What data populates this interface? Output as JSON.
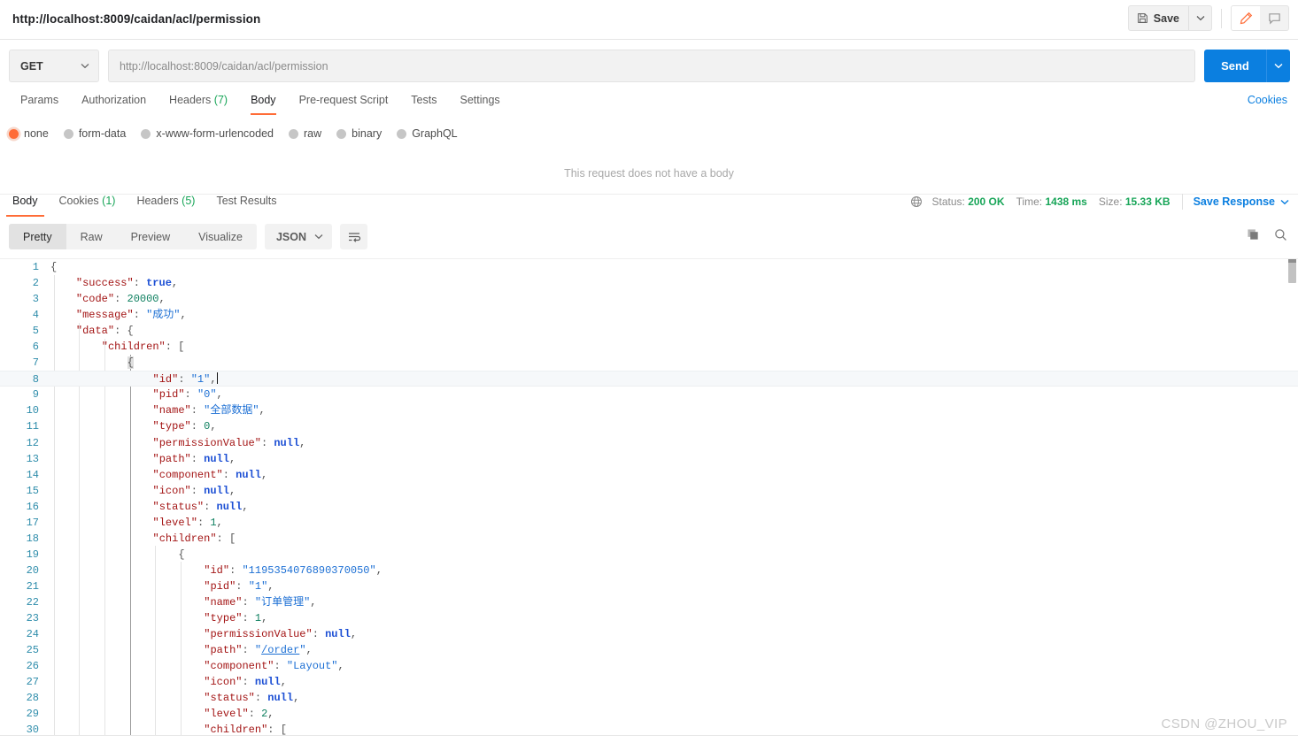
{
  "window": {
    "tab_title": "http://localhost:8009/caidan/acl/permission"
  },
  "titlebar": {
    "save_label": "Save",
    "save_icon": "floppy-disk-icon",
    "save_caret_icon": "chevron-down-icon",
    "edit_icon": "pencil-icon",
    "comment_icon": "comment-icon",
    "accent_orange": "#ff6c37"
  },
  "request": {
    "method": "GET",
    "method_caret_icon": "chevron-down-icon",
    "url_value": "http://localhost:8009/caidan/acl/permission",
    "send_label": "Send",
    "send_caret_icon": "chevron-down-icon",
    "send_color": "#0b7fe0",
    "tabs": [
      {
        "label": "Params",
        "count": "",
        "active": false
      },
      {
        "label": "Authorization",
        "count": "",
        "active": false
      },
      {
        "label": "Headers",
        "count": "(7)",
        "active": false
      },
      {
        "label": "Body",
        "count": "",
        "active": true
      },
      {
        "label": "Pre-request Script",
        "count": "",
        "active": false
      },
      {
        "label": "Tests",
        "count": "",
        "active": false
      },
      {
        "label": "Settings",
        "count": "",
        "active": false
      }
    ],
    "cookies_link": "Cookies",
    "body_types": [
      {
        "label": "none",
        "selected": true
      },
      {
        "label": "form-data",
        "selected": false
      },
      {
        "label": "x-www-form-urlencoded",
        "selected": false
      },
      {
        "label": "raw",
        "selected": false
      },
      {
        "label": "binary",
        "selected": false
      },
      {
        "label": "GraphQL",
        "selected": false
      }
    ],
    "no_body_message": "This request does not have a body"
  },
  "response": {
    "tabs": [
      {
        "label": "Body",
        "count": "",
        "active": true
      },
      {
        "label": "Cookies",
        "count": "(1)",
        "active": false
      },
      {
        "label": "Headers",
        "count": "(5)",
        "active": false
      },
      {
        "label": "Test Results",
        "count": "",
        "active": false
      }
    ],
    "globe_icon": "globe-icon",
    "status_label": "Status:",
    "status_value": "200 OK",
    "time_label": "Time:",
    "time_value": "1438 ms",
    "size_label": "Size:",
    "size_value": "15.33 KB",
    "save_response_label": "Save Response",
    "save_response_caret_icon": "chevron-down-icon",
    "view_modes": [
      {
        "label": "Pretty",
        "active": true
      },
      {
        "label": "Raw",
        "active": false
      },
      {
        "label": "Preview",
        "active": false
      },
      {
        "label": "Visualize",
        "active": false
      }
    ],
    "format": "JSON",
    "format_caret_icon": "chevron-down-icon",
    "wrap_icon": "word-wrap-icon",
    "copy_icon": "copy-icon",
    "search_icon": "search-icon",
    "status_color": "#18a558"
  },
  "code": {
    "lines": [
      {
        "n": "1",
        "indent": 0,
        "tokens": [
          {
            "t": "punc",
            "v": "{"
          }
        ]
      },
      {
        "n": "2",
        "indent": 1,
        "tokens": [
          {
            "t": "key",
            "v": "\"success\""
          },
          {
            "t": "punc",
            "v": ": "
          },
          {
            "t": "bool",
            "v": "true"
          },
          {
            "t": "punc",
            "v": ","
          }
        ]
      },
      {
        "n": "3",
        "indent": 1,
        "tokens": [
          {
            "t": "key",
            "v": "\"code\""
          },
          {
            "t": "punc",
            "v": ": "
          },
          {
            "t": "num",
            "v": "20000"
          },
          {
            "t": "punc",
            "v": ","
          }
        ]
      },
      {
        "n": "4",
        "indent": 1,
        "tokens": [
          {
            "t": "key",
            "v": "\"message\""
          },
          {
            "t": "punc",
            "v": ": "
          },
          {
            "t": "str",
            "v": "\"成功\""
          },
          {
            "t": "punc",
            "v": ","
          }
        ]
      },
      {
        "n": "5",
        "indent": 1,
        "tokens": [
          {
            "t": "key",
            "v": "\"data\""
          },
          {
            "t": "punc",
            "v": ": "
          },
          {
            "t": "punc",
            "v": "{"
          }
        ]
      },
      {
        "n": "6",
        "indent": 2,
        "tokens": [
          {
            "t": "key",
            "v": "\"children\""
          },
          {
            "t": "punc",
            "v": ": "
          },
          {
            "t": "punc",
            "v": "["
          }
        ]
      },
      {
        "n": "7",
        "indent": 3,
        "tokens": [
          {
            "t": "brace",
            "v": "{"
          }
        ]
      },
      {
        "n": "8",
        "indent": 4,
        "highlight": true,
        "cursor": true,
        "tokens": [
          {
            "t": "key",
            "v": "\"id\""
          },
          {
            "t": "punc",
            "v": ": "
          },
          {
            "t": "str",
            "v": "\"1\""
          },
          {
            "t": "punc",
            "v": ","
          }
        ]
      },
      {
        "n": "9",
        "indent": 4,
        "tokens": [
          {
            "t": "key",
            "v": "\"pid\""
          },
          {
            "t": "punc",
            "v": ": "
          },
          {
            "t": "str",
            "v": "\"0\""
          },
          {
            "t": "punc",
            "v": ","
          }
        ]
      },
      {
        "n": "10",
        "indent": 4,
        "tokens": [
          {
            "t": "key",
            "v": "\"name\""
          },
          {
            "t": "punc",
            "v": ": "
          },
          {
            "t": "str",
            "v": "\"全部数据\""
          },
          {
            "t": "punc",
            "v": ","
          }
        ]
      },
      {
        "n": "11",
        "indent": 4,
        "tokens": [
          {
            "t": "key",
            "v": "\"type\""
          },
          {
            "t": "punc",
            "v": ": "
          },
          {
            "t": "num",
            "v": "0"
          },
          {
            "t": "punc",
            "v": ","
          }
        ]
      },
      {
        "n": "12",
        "indent": 4,
        "tokens": [
          {
            "t": "key",
            "v": "\"permissionValue\""
          },
          {
            "t": "punc",
            "v": ": "
          },
          {
            "t": "null",
            "v": "null"
          },
          {
            "t": "punc",
            "v": ","
          }
        ]
      },
      {
        "n": "13",
        "indent": 4,
        "tokens": [
          {
            "t": "key",
            "v": "\"path\""
          },
          {
            "t": "punc",
            "v": ": "
          },
          {
            "t": "null",
            "v": "null"
          },
          {
            "t": "punc",
            "v": ","
          }
        ]
      },
      {
        "n": "14",
        "indent": 4,
        "tokens": [
          {
            "t": "key",
            "v": "\"component\""
          },
          {
            "t": "punc",
            "v": ": "
          },
          {
            "t": "null",
            "v": "null"
          },
          {
            "t": "punc",
            "v": ","
          }
        ]
      },
      {
        "n": "15",
        "indent": 4,
        "tokens": [
          {
            "t": "key",
            "v": "\"icon\""
          },
          {
            "t": "punc",
            "v": ": "
          },
          {
            "t": "null",
            "v": "null"
          },
          {
            "t": "punc",
            "v": ","
          }
        ]
      },
      {
        "n": "16",
        "indent": 4,
        "tokens": [
          {
            "t": "key",
            "v": "\"status\""
          },
          {
            "t": "punc",
            "v": ": "
          },
          {
            "t": "null",
            "v": "null"
          },
          {
            "t": "punc",
            "v": ","
          }
        ]
      },
      {
        "n": "17",
        "indent": 4,
        "tokens": [
          {
            "t": "key",
            "v": "\"level\""
          },
          {
            "t": "punc",
            "v": ": "
          },
          {
            "t": "num",
            "v": "1"
          },
          {
            "t": "punc",
            "v": ","
          }
        ]
      },
      {
        "n": "18",
        "indent": 4,
        "tokens": [
          {
            "t": "key",
            "v": "\"children\""
          },
          {
            "t": "punc",
            "v": ": "
          },
          {
            "t": "punc",
            "v": "["
          }
        ]
      },
      {
        "n": "19",
        "indent": 5,
        "tokens": [
          {
            "t": "punc",
            "v": "{"
          }
        ]
      },
      {
        "n": "20",
        "indent": 6,
        "tokens": [
          {
            "t": "key",
            "v": "\"id\""
          },
          {
            "t": "punc",
            "v": ": "
          },
          {
            "t": "str",
            "v": "\"1195354076890370050\""
          },
          {
            "t": "punc",
            "v": ","
          }
        ]
      },
      {
        "n": "21",
        "indent": 6,
        "tokens": [
          {
            "t": "key",
            "v": "\"pid\""
          },
          {
            "t": "punc",
            "v": ": "
          },
          {
            "t": "str",
            "v": "\"1\""
          },
          {
            "t": "punc",
            "v": ","
          }
        ]
      },
      {
        "n": "22",
        "indent": 6,
        "tokens": [
          {
            "t": "key",
            "v": "\"name\""
          },
          {
            "t": "punc",
            "v": ": "
          },
          {
            "t": "str",
            "v": "\"订单管理\""
          },
          {
            "t": "punc",
            "v": ","
          }
        ]
      },
      {
        "n": "23",
        "indent": 6,
        "tokens": [
          {
            "t": "key",
            "v": "\"type\""
          },
          {
            "t": "punc",
            "v": ": "
          },
          {
            "t": "num",
            "v": "1"
          },
          {
            "t": "punc",
            "v": ","
          }
        ]
      },
      {
        "n": "24",
        "indent": 6,
        "tokens": [
          {
            "t": "key",
            "v": "\"permissionValue\""
          },
          {
            "t": "punc",
            "v": ": "
          },
          {
            "t": "null",
            "v": "null"
          },
          {
            "t": "punc",
            "v": ","
          }
        ]
      },
      {
        "n": "25",
        "indent": 6,
        "tokens": [
          {
            "t": "key",
            "v": "\"path\""
          },
          {
            "t": "punc",
            "v": ": "
          },
          {
            "t": "str",
            "v": "\""
          },
          {
            "t": "link",
            "v": "/order"
          },
          {
            "t": "str",
            "v": "\""
          },
          {
            "t": "punc",
            "v": ","
          }
        ]
      },
      {
        "n": "26",
        "indent": 6,
        "tokens": [
          {
            "t": "key",
            "v": "\"component\""
          },
          {
            "t": "punc",
            "v": ": "
          },
          {
            "t": "str",
            "v": "\"Layout\""
          },
          {
            "t": "punc",
            "v": ","
          }
        ]
      },
      {
        "n": "27",
        "indent": 6,
        "tokens": [
          {
            "t": "key",
            "v": "\"icon\""
          },
          {
            "t": "punc",
            "v": ": "
          },
          {
            "t": "null",
            "v": "null"
          },
          {
            "t": "punc",
            "v": ","
          }
        ]
      },
      {
        "n": "28",
        "indent": 6,
        "tokens": [
          {
            "t": "key",
            "v": "\"status\""
          },
          {
            "t": "punc",
            "v": ": "
          },
          {
            "t": "null",
            "v": "null"
          },
          {
            "t": "punc",
            "v": ","
          }
        ]
      },
      {
        "n": "29",
        "indent": 6,
        "tokens": [
          {
            "t": "key",
            "v": "\"level\""
          },
          {
            "t": "punc",
            "v": ": "
          },
          {
            "t": "num",
            "v": "2"
          },
          {
            "t": "punc",
            "v": ","
          }
        ]
      },
      {
        "n": "30",
        "indent": 6,
        "tokens": [
          {
            "t": "key",
            "v": "\"children\""
          },
          {
            "t": "punc",
            "v": ": "
          },
          {
            "t": "punc",
            "v": "["
          }
        ]
      }
    ]
  },
  "watermark": "CSDN @ZHOU_VIP"
}
